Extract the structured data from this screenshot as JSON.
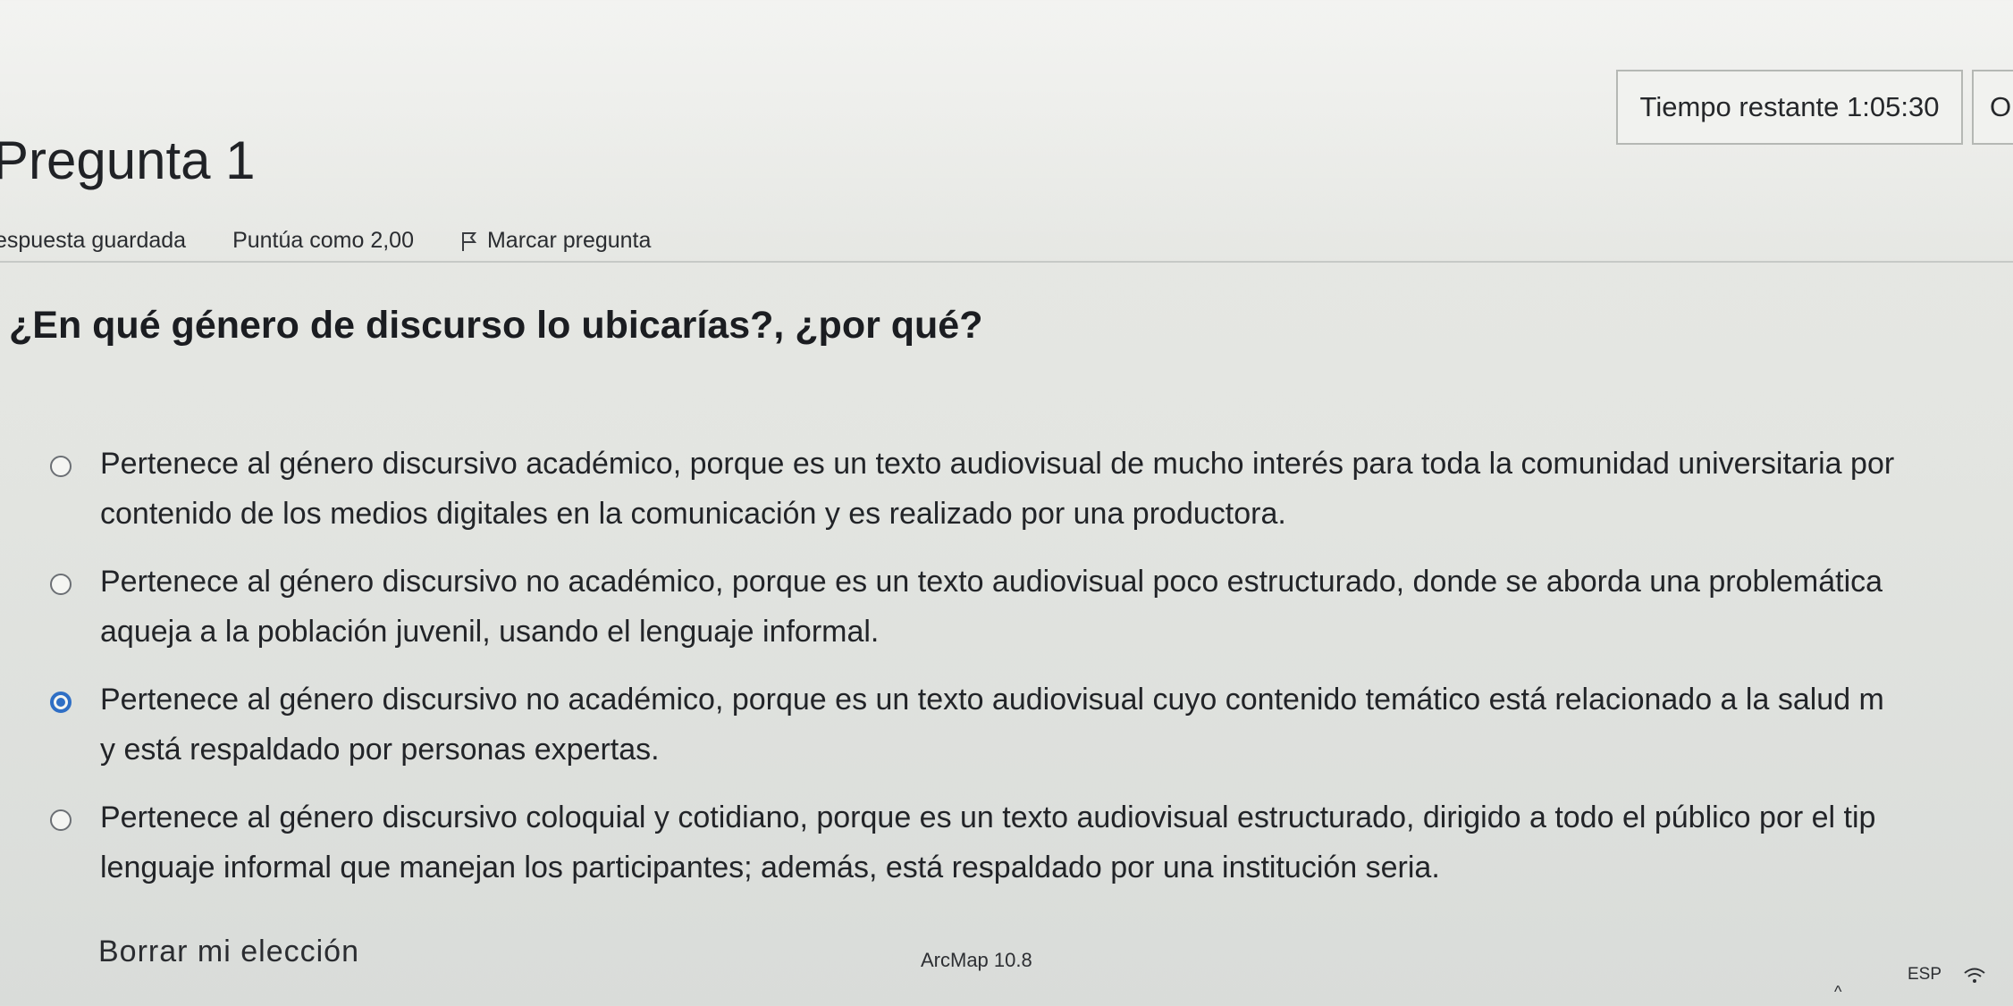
{
  "timer": {
    "label": "Tiempo restante 1:05:30",
    "extra": "O"
  },
  "question": {
    "title": "Pregunta 1",
    "status": "espuesta guardada",
    "points": "Puntúa como 2,00",
    "flag_label": "Marcar pregunta",
    "prompt": "¿En qué género de discurso lo ubicarías?, ¿por qué?"
  },
  "options": [
    {
      "line1": "Pertenece al género discursivo académico, porque es un texto audiovisual de mucho interés para toda la comunidad universitaria por",
      "line2": "contenido de los medios digitales en la comunicación y es realizado por una productora.",
      "selected": false
    },
    {
      "line1": "Pertenece al género discursivo no académico, porque es un texto audiovisual poco estructurado, donde se aborda una problemática",
      "line2": "aqueja a la población juvenil, usando el lenguaje informal.",
      "selected": false
    },
    {
      "line1": "Pertenece al género discursivo no académico, porque es un texto audiovisual cuyo contenido temático está relacionado a la salud m",
      "line2": "y está respaldado por personas expertas.",
      "selected": true
    },
    {
      "line1": "Pertenece al género discursivo coloquial y cotidiano, porque es un texto audiovisual estructurado, dirigido a todo el público por el tip",
      "line2": "lenguaje informal que manejan los participantes; además, está respaldado por una institución seria.",
      "selected": false
    }
  ],
  "clear_choice": "Borrar mi elección",
  "taskbar": {
    "tooltip": "ArcMap 10.8",
    "language": "ESP"
  },
  "colors": {
    "accent": "#2f6fc5"
  }
}
